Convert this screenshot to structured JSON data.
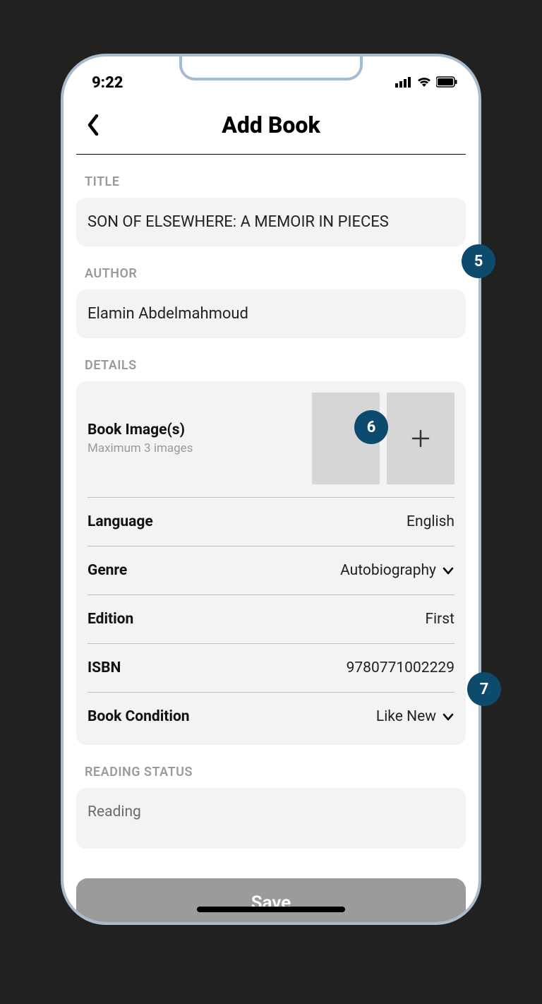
{
  "status": {
    "time": "9:22"
  },
  "header": {
    "title": "Add Book"
  },
  "title_section": {
    "label": "TITLE",
    "value": "SON OF ELSEWHERE: A MEMOIR IN PIECES"
  },
  "author_section": {
    "label": "AUTHOR",
    "value": "Elamin Abdelmahmoud"
  },
  "details": {
    "label": "DETAILS",
    "images": {
      "label": "Book Image(s)",
      "sub": "Maximum 3 images"
    },
    "language": {
      "key": "Language",
      "value": "English"
    },
    "genre": {
      "key": "Genre",
      "value": "Autobiography"
    },
    "edition": {
      "key": "Edition",
      "value": "First"
    },
    "isbn": {
      "key": "ISBN",
      "value": "9780771002229"
    },
    "condition": {
      "key": "Book Condition",
      "value": "Like New"
    }
  },
  "reading_status": {
    "label": "READING STATUS",
    "value": "Reading"
  },
  "save": {
    "label": "Save"
  },
  "annotations": {
    "b5": "5",
    "b6": "6",
    "b7": "7"
  }
}
